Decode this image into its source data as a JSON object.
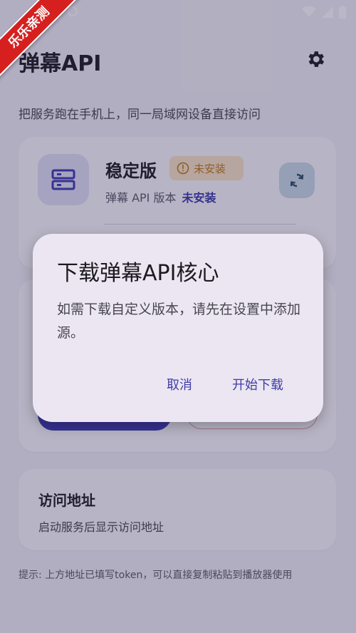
{
  "ribbon": {
    "text": "乐乐亲测"
  },
  "header": {
    "title": "弹幕API",
    "subtitle": "把服务跑在手机上，同一局域网设备直接访问"
  },
  "version_card": {
    "title": "稳定版",
    "badge": "未安装",
    "version_label": "弹幕 API 版本",
    "version_value": "未安装"
  },
  "access_card": {
    "title": "访问地址",
    "desc": "启动服务后显示访问地址"
  },
  "tip": "提示: 上方地址已填写token，可以直接复制粘贴到播放器使用",
  "dialog": {
    "title": "下载弹幕API核心",
    "body": "如需下载自定义版本，请先在设置中添加源。",
    "cancel": "取消",
    "confirm": "开始下载"
  },
  "colors": {
    "accent": "#3d3ab0",
    "badge_bg": "#fbe3c5",
    "badge_fg": "#c07a12"
  },
  "icons": [
    "sync-icon",
    "signal-icon",
    "battery-icon",
    "settings-icon",
    "server-icon",
    "info-icon",
    "refresh-icon"
  ]
}
